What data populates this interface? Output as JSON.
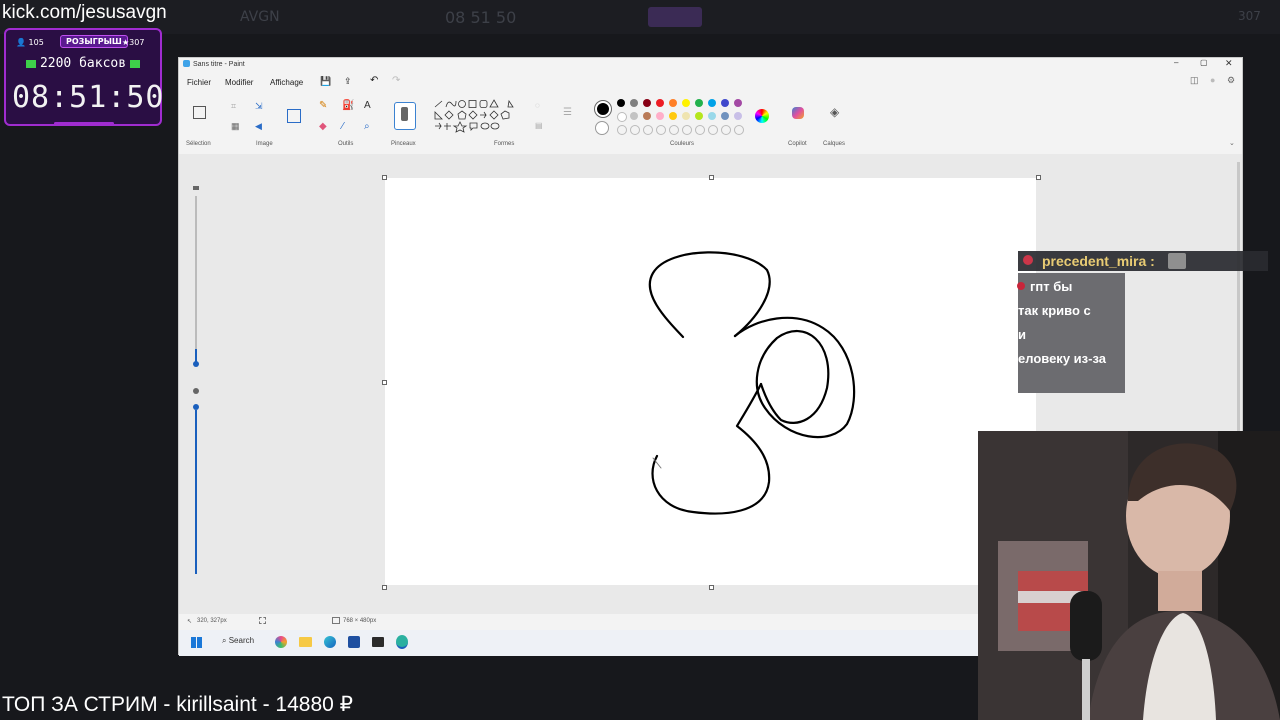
{
  "stream": {
    "url": "kick.com/jesusavgn",
    "bottom_ticker": "ТОП ЗА СТРИМ - kirillsaint - 14880 ₽",
    "bg_header_timer": "08 51 50",
    "bg_header_channel": "AVGN",
    "bg_header_count": "307"
  },
  "timer_widget": {
    "viewers": "105",
    "giveaway_label": "РОЗЫГРЫШ",
    "stars": "307",
    "prize": "2200 баксов",
    "clock": "08:51:50"
  },
  "paint": {
    "window_title": "Sans titre - Paint",
    "menu": [
      "Fichier",
      "Modifier",
      "Affichage"
    ],
    "groups": {
      "selection": "Sélection",
      "image": "Image",
      "tools": "Outils",
      "brushes": "Pinceaux",
      "shapes": "Formes",
      "colors": "Couleurs",
      "copilot": "Copilot",
      "layers": "Calques"
    },
    "status_cursor": "320, 327px",
    "status_size": "768 × 480px",
    "palette_row1": [
      "#000000",
      "#7f7f7f",
      "#880015",
      "#ed1c24",
      "#ff7f27",
      "#fff200",
      "#22b14c",
      "#00a2e8",
      "#3f48cc",
      "#a349a4"
    ],
    "palette_row2": [
      "#ffffff",
      "#c3c3c3",
      "#b97a57",
      "#ffaec9",
      "#ffc90e",
      "#efe4b0",
      "#b5e61d",
      "#99d9ea",
      "#7092be",
      "#c8bfe7"
    ],
    "taskbar_search": "Search"
  },
  "chat": {
    "username": "precedent_mira :",
    "lines": [
      "гпт бы",
      "так криво с",
      "и",
      "еловеку из-за"
    ]
  }
}
